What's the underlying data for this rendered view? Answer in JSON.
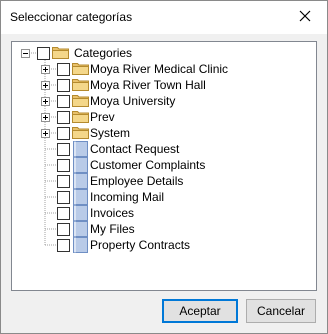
{
  "window": {
    "title": "Seleccionar categorías"
  },
  "tree": {
    "root": {
      "label": "Categories",
      "expanded": true
    },
    "folders": [
      {
        "label": "Moya River Medical Clinic"
      },
      {
        "label": "Moya River Town Hall"
      },
      {
        "label": "Moya University"
      },
      {
        "label": "Prev"
      },
      {
        "label": "System"
      }
    ],
    "categories": [
      {
        "label": "Contact Request"
      },
      {
        "label": "Customer Complaints"
      },
      {
        "label": "Employee Details"
      },
      {
        "label": "Incoming Mail"
      },
      {
        "label": "Invoices"
      },
      {
        "label": "My Files"
      },
      {
        "label": "Property Contracts"
      }
    ]
  },
  "buttons": {
    "ok": "Aceptar",
    "cancel": "Cancelar"
  },
  "colors": {
    "folder": "#e9c16b",
    "category_icon": "#b9cbe8",
    "primary_border": "#0078d7"
  }
}
